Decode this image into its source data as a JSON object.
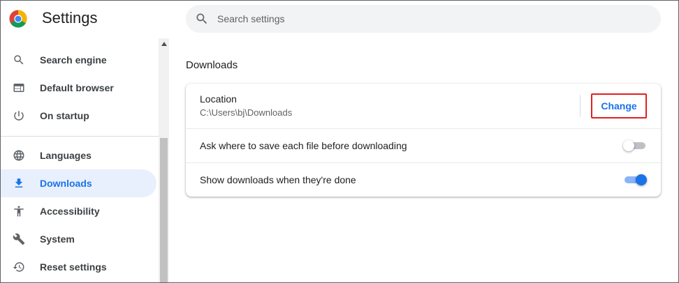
{
  "app": {
    "title": "Settings"
  },
  "search": {
    "placeholder": "Search settings",
    "value": ""
  },
  "sidebar": {
    "items": [
      {
        "label": "Search engine",
        "icon": "search-icon",
        "active": false
      },
      {
        "label": "Default browser",
        "icon": "browser-window-icon",
        "active": false
      },
      {
        "label": "On startup",
        "icon": "power-icon",
        "active": false
      },
      {
        "label": "Languages",
        "icon": "globe-icon",
        "active": false
      },
      {
        "label": "Downloads",
        "icon": "download-icon",
        "active": true
      },
      {
        "label": "Accessibility",
        "icon": "accessibility-icon",
        "active": false
      },
      {
        "label": "System",
        "icon": "wrench-icon",
        "active": false
      },
      {
        "label": "Reset settings",
        "icon": "reset-history-icon",
        "active": false
      }
    ]
  },
  "downloads": {
    "section_title": "Downloads",
    "location_label": "Location",
    "location_path": "C:\\Users\\bj\\Downloads",
    "change_label": "Change",
    "ask_label": "Ask where to save each file before downloading",
    "ask_enabled": false,
    "show_label": "Show downloads when they're done",
    "show_enabled": true
  },
  "colors": {
    "accent": "#1a73e8",
    "active_bg": "#e8f0fe",
    "highlight_border": "#e02020"
  }
}
